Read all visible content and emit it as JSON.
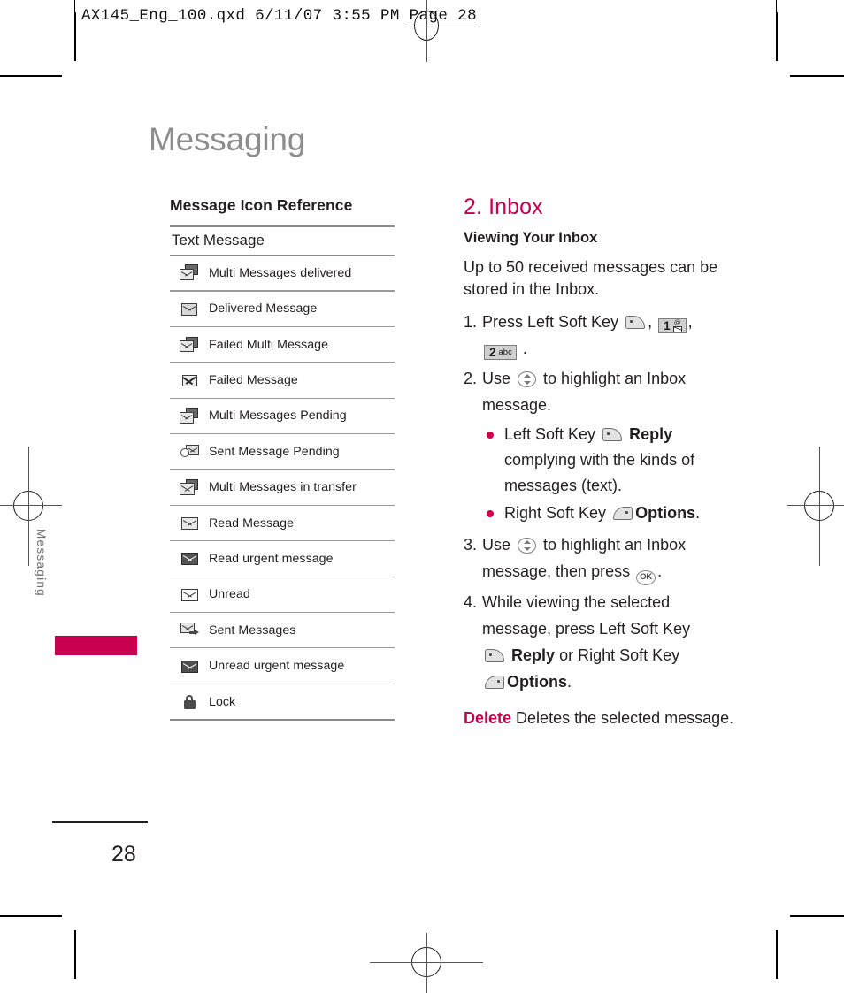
{
  "printer_slug": "AX145_Eng_100.qxd   6/11/07   3:55 PM   Page 28",
  "page": {
    "title": "Messaging",
    "side_tab_label": "Messaging",
    "folio": "28",
    "accent_color": "#c8004e"
  },
  "left_column": {
    "heading": "Message Icon Reference",
    "table_subhead": "Text Message",
    "rows": [
      {
        "icon": "multi-messages-delivered-icon",
        "label": "Multi Messages delivered"
      },
      {
        "icon": "delivered-message-icon",
        "label": "Delivered Message"
      },
      {
        "icon": "failed-multi-message-icon",
        "label": "Failed Multi Message"
      },
      {
        "icon": "failed-message-icon",
        "label": "Failed Message"
      },
      {
        "icon": "multi-messages-pending-icon",
        "label": "Multi Messages Pending"
      },
      {
        "icon": "sent-message-pending-icon",
        "label": "Sent Message Pending"
      },
      {
        "icon": "multi-messages-in-transfer-icon",
        "label": "Multi Messages in transfer"
      },
      {
        "icon": "read-message-icon",
        "label": "Read Message"
      },
      {
        "icon": "read-urgent-message-icon",
        "label": "Read urgent message"
      },
      {
        "icon": "unread-icon",
        "label": "Unread"
      },
      {
        "icon": "sent-messages-icon",
        "label": "Sent Messages"
      },
      {
        "icon": "unread-urgent-message-icon",
        "label": "Unread urgent message"
      },
      {
        "icon": "lock-icon",
        "label": "Lock"
      }
    ]
  },
  "right_column": {
    "section_number_title": "2. Inbox",
    "subheading": "Viewing Your Inbox",
    "intro": "Up to 50 received messages can be stored in the Inbox.",
    "steps": [
      {
        "num": "1.",
        "text_before": "Press Left Soft Key",
        "key1": "left-soft-key",
        "comma1": ",",
        "key2_big": "1",
        "comma2": ",",
        "key3_big": "2",
        "key3_small": "abc",
        "period": "."
      },
      {
        "num": "2.",
        "text_before": "Use",
        "nav_key": "nav-up-down-key",
        "text_after": "to highlight an Inbox message."
      },
      {
        "num": "3.",
        "text_before": "Use",
        "nav_key": "nav-up-down-key",
        "text_mid": "to highlight an Inbox message, then press",
        "ok_key": "OK",
        "period": "."
      },
      {
        "num": "4.",
        "text_before": "While viewing the selected message, press Left Soft Key",
        "bold1": "Reply",
        "text_mid": "or Right Soft Key",
        "bold2": "Options",
        "period": "."
      }
    ],
    "bullets": [
      {
        "text_before": "Left Soft Key",
        "bold": "Reply",
        "text_after": "complying with the kinds of messages (text)."
      },
      {
        "text_before": "Right Soft Key",
        "bold": "Options",
        "text_after": "."
      }
    ],
    "delete_note": {
      "term": "Delete",
      "description": "Deletes the selected message."
    }
  }
}
